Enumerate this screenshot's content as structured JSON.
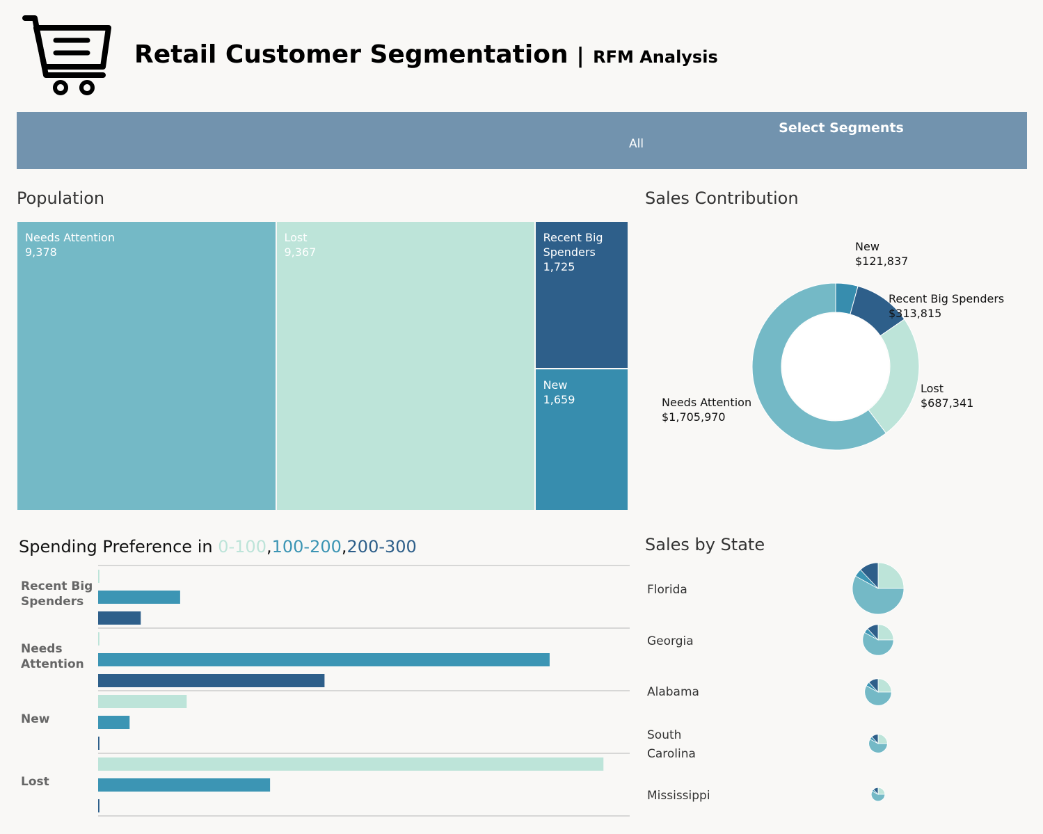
{
  "header": {
    "title": "Retail Customer Segmentation",
    "separator": "|",
    "subtitle": "RFM Analysis",
    "logo_icon": "shopping-cart-icon"
  },
  "filter": {
    "label": "Select Segments",
    "value": "All"
  },
  "colors": {
    "light": "#bde4d9",
    "mid": "#3c95b4",
    "dark": "#2e5f8a",
    "teal": "#74b9c6",
    "filter_bg": "#7293ae"
  },
  "population": {
    "title": "Population",
    "chart_data": {
      "type": "treemap",
      "items": [
        {
          "name": "Needs Attention",
          "value": 9378,
          "label": "9,378",
          "color": "#74b9c6",
          "text_color": "#ffffff"
        },
        {
          "name": "Lost",
          "value": 9367,
          "label": "9,367",
          "color": "#bde4d9",
          "text_color": "#ffffff"
        },
        {
          "name": "Recent Big Spenders",
          "value": 1725,
          "label": "1,725",
          "color": "#2e5f8a",
          "text_color": "#ffffff"
        },
        {
          "name": "New",
          "value": 1659,
          "label": "1,659",
          "color": "#378dae",
          "text_color": "#ffffff"
        }
      ]
    }
  },
  "sales_contribution": {
    "title": "Sales Contribution",
    "chart_data": {
      "type": "pie",
      "donut": true,
      "slices": [
        {
          "name": "New",
          "value": 121837,
          "label": "$121,837",
          "color": "#378dae"
        },
        {
          "name": "Recent Big Spenders",
          "value": 313815,
          "label": "$313,815",
          "color": "#2e5f8a"
        },
        {
          "name": "Lost",
          "value": 687341,
          "label": "$687,341",
          "color": "#bde4d9"
        },
        {
          "name": "Needs Attention",
          "value": 1705970,
          "label": "$1,705,970",
          "color": "#74b9c6"
        }
      ]
    }
  },
  "spending": {
    "title_prefix": "Spending Preference in ",
    "ranges": [
      "0-100",
      "100-200",
      "200-300"
    ],
    "comma": ",",
    "chart_data": {
      "type": "bar",
      "orientation": "horizontal",
      "categories": [
        "Recent Big Spenders",
        "Needs Attention",
        "New",
        "Lost"
      ],
      "series": [
        {
          "name": "0-100",
          "color": "#bde4d9",
          "values": [
            2,
            2,
            135,
            770
          ]
        },
        {
          "name": "100-200",
          "color": "#3c95b4",
          "values": [
            125,
            688,
            48,
            262
          ]
        },
        {
          "name": "200-300",
          "color": "#2e5f8a",
          "values": [
            65,
            345,
            2,
            2
          ]
        }
      ],
      "xlim": [
        0,
        810
      ]
    }
  },
  "sales_by_state": {
    "title": "Sales by State",
    "chart_data": {
      "type": "pie",
      "states": [
        {
          "name": "Florida",
          "total": 100,
          "shares": [
            0.25,
            0.58,
            0.05,
            0.12
          ]
        },
        {
          "name": "Georgia",
          "total": 36,
          "shares": [
            0.25,
            0.58,
            0.05,
            0.12
          ]
        },
        {
          "name": "Alabama",
          "total": 27,
          "shares": [
            0.25,
            0.58,
            0.05,
            0.12
          ]
        },
        {
          "name": "South Carolina",
          "total": 13,
          "shares": [
            0.25,
            0.58,
            0.05,
            0.12
          ]
        },
        {
          "name": "Mississippi",
          "total": 7,
          "shares": [
            0.25,
            0.58,
            0.05,
            0.12
          ]
        }
      ],
      "series": [
        "Lost",
        "Needs Attention",
        "New",
        "Recent Big Spenders"
      ]
    }
  }
}
